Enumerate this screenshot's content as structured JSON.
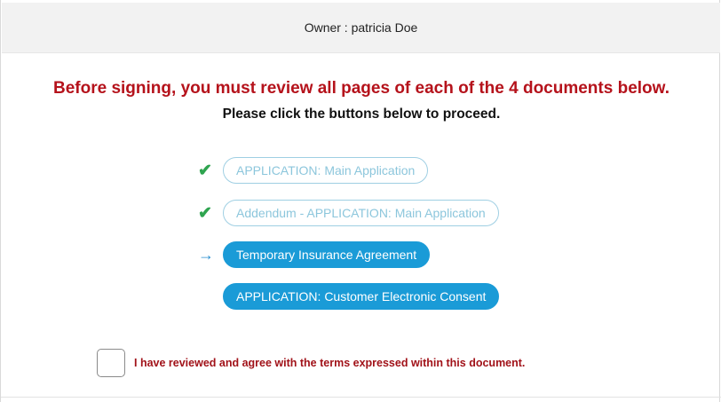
{
  "owner_bar": {
    "text": "Owner : patricia Doe"
  },
  "instructions": {
    "headline": "Before signing, you must review all pages of each of the 4 documents below.",
    "subline": "Please click the buttons below to proceed."
  },
  "documents": [
    {
      "label": "APPLICATION: Main Application",
      "status": "reviewed",
      "marker_icon": "check-icon"
    },
    {
      "label": "Addendum - APPLICATION: Main Application",
      "status": "reviewed",
      "marker_icon": "check-icon"
    },
    {
      "label": "Temporary Insurance Agreement",
      "status": "current",
      "marker_icon": "arrow-right-icon"
    },
    {
      "label": "APPLICATION: Customer Electronic Consent",
      "status": "pending",
      "marker_icon": ""
    }
  ],
  "agreement": {
    "label": "I have reviewed and agree with the terms expressed within this document.",
    "checked": false
  },
  "colors": {
    "headline": "#b5121b",
    "primary_button": "#1a9bd7",
    "reviewed_button_text": "#8cc6dc",
    "check": "#2ea44f",
    "arrow": "#2a8fd0"
  }
}
